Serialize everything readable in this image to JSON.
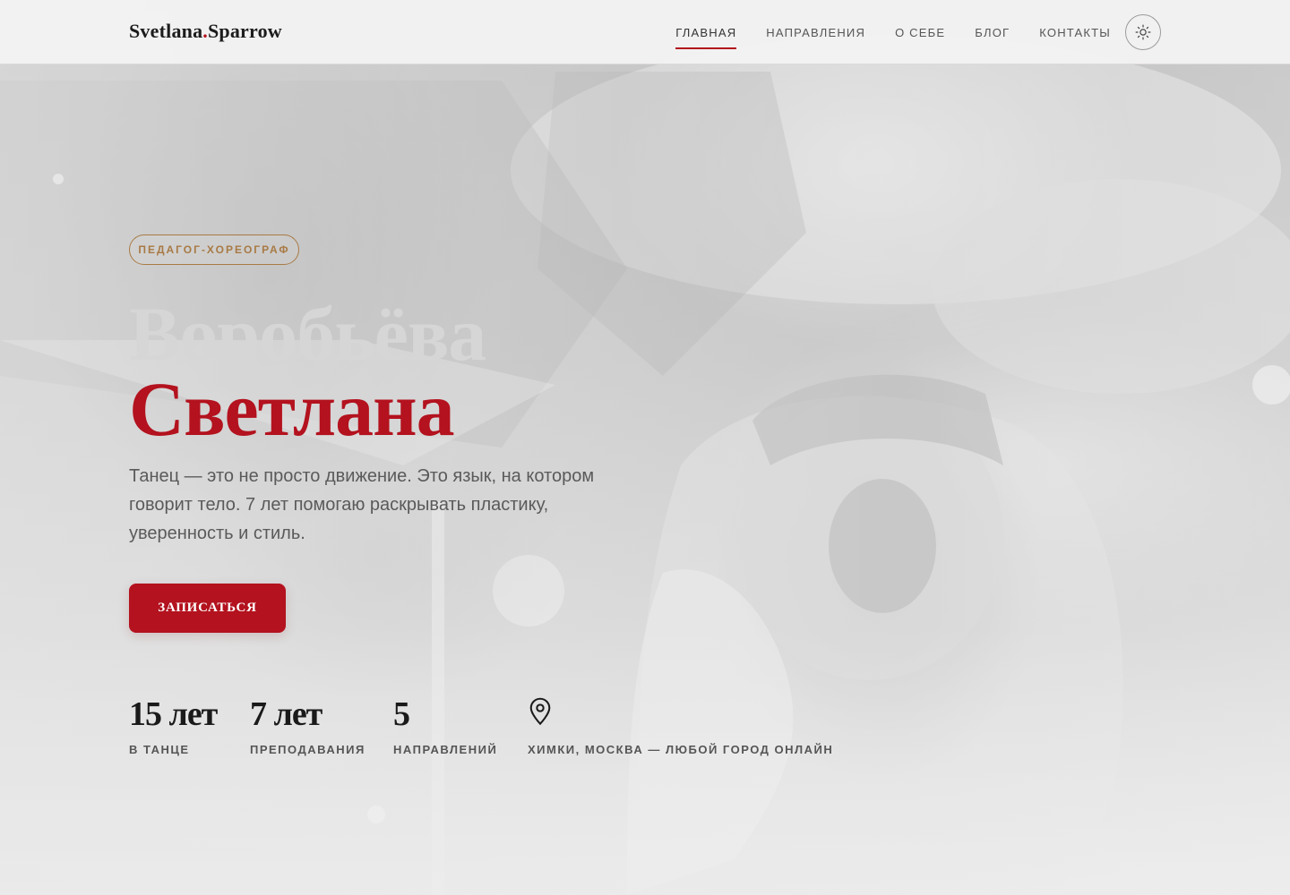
{
  "header": {
    "logo_name": "Svetlana",
    "logo_dot": ".",
    "logo_surname": "Sparrow",
    "nav": [
      {
        "label": "Главная",
        "active": true
      },
      {
        "label": "Направления",
        "active": false
      },
      {
        "label": "О себе",
        "active": false
      },
      {
        "label": "Блог",
        "active": false
      },
      {
        "label": "Контакты",
        "active": false
      }
    ],
    "theme_toggle_icon": "sun-icon"
  },
  "hero": {
    "role": "Педагог-хореограф",
    "surname": "Воробьёва",
    "firstname": "Светлана",
    "tagline": "Танец — это не просто движение. Это язык, на котором говорит тело. 7 лет помогаю раскрывать пластику, уверенность и стиль.",
    "cta_label": "Записаться"
  },
  "stats": [
    {
      "value": "15 лет",
      "label": "В танце"
    },
    {
      "value": "7 лет",
      "label": "Преподавания"
    },
    {
      "value": "5",
      "label": "Направлений"
    },
    {
      "icon": "map-pin-icon",
      "label": "Химки, Москва — любой город онлайн"
    }
  ],
  "colors": {
    "accent": "#b3121e",
    "badge": "#a87a45",
    "header_bg": "#f4f3f2"
  }
}
